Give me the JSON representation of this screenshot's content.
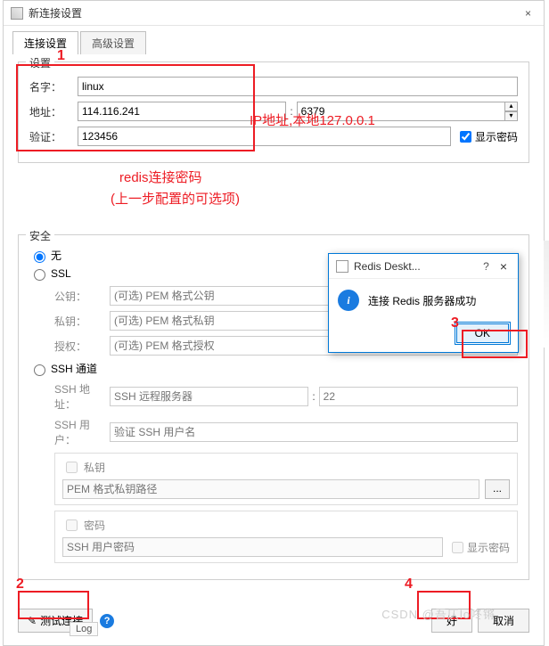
{
  "window": {
    "title": "新连接设置",
    "tabs": {
      "active": "连接设置",
      "inactive": "高级设置"
    }
  },
  "settings_group": {
    "legend": "设置",
    "name_label": "名字：",
    "name_value": "linux",
    "addr_label": "地址：",
    "addr_value": "114.116.241",
    "port_value": "6379",
    "auth_label": "验证：",
    "auth_value": "123456",
    "show_pw_label": "显示密码"
  },
  "security_group": {
    "legend": "安全",
    "none": "无",
    "ssl": "SSL",
    "pubkey_label": "公钥：",
    "pubkey_ph": "(可选) PEM 格式公钥",
    "privkey_label": "私钥：",
    "privkey_ph": "(可选) PEM 格式私钥",
    "auth_label": "授权：",
    "auth_ph": "(可选) PEM 格式授权",
    "ssh": "SSH 通道",
    "ssh_addr_label": "SSH 地址：",
    "ssh_addr_ph": "SSH 远程服务器",
    "ssh_port_ph": "22",
    "ssh_user_label": "SSH 用户：",
    "ssh_user_ph": "验证 SSH 用户名",
    "privkey_chk": "私钥",
    "privkey_path_ph": "PEM 格式私钥路径",
    "browse": "...",
    "password_chk": "密码",
    "password_ph": "SSH 用户密码",
    "show_pw_chk": "显示密码"
  },
  "footer": {
    "test": "测试连接",
    "help": "?",
    "ok": "好",
    "cancel": "取消"
  },
  "modal": {
    "title": "Redis Deskt...",
    "help": "?",
    "close": "×",
    "message": "连接 Redis 服务器成功",
    "ok": "OK"
  },
  "annotations": {
    "n1": "1",
    "n2": "2",
    "n3": "3",
    "n4": "4",
    "ip_hint": "IP地址,本地127.0.0.1",
    "pw_hint1": "redis连接密码",
    "pw_hint2": "(上一步配置的可选项)"
  },
  "watermark": "CSDN @吾仄lo咚锵",
  "bottom_slice": "Log"
}
